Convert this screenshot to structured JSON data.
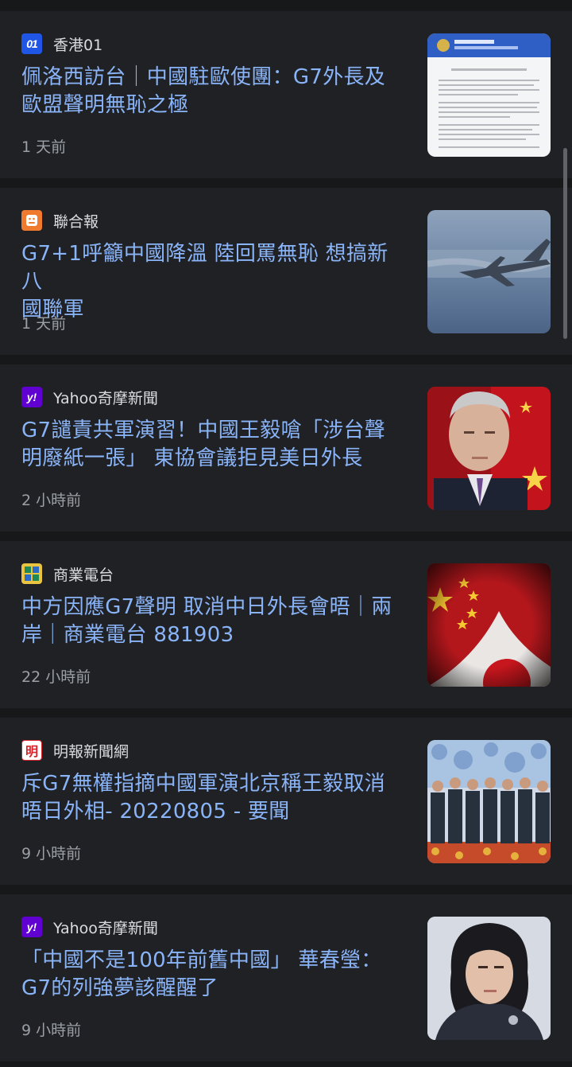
{
  "articles": [
    {
      "source": "香港01",
      "logo": "hk01-logo",
      "logo_color": "#1f56e6",
      "headline_lines": [
        "佩洛西訪台｜中國駐歐使團：G7外長及",
        "歐盟聲明無恥之極"
      ],
      "time": "1 天前",
      "thumbnail": "statement-document-image"
    },
    {
      "source": "聯合報",
      "logo": "udn-logo",
      "logo_color": "#f07a2e",
      "headline_lines": [
        "G7+1呼籲中國降溫 陸回罵無恥 想搞新八",
        "國聯軍"
      ],
      "time": "1 天前",
      "thumbnail": "military-aircraft-image"
    },
    {
      "source": "Yahoo奇摩新聞",
      "logo": "yahoo-logo",
      "logo_color": "#6001d2",
      "headline_lines": [
        "G7譴責共軍演習！中國王毅嗆「涉台聲",
        "明廢紙一張」 東協會議拒見美日外長"
      ],
      "time": "2 小時前",
      "thumbnail": "wang-yi-portrait-image"
    },
    {
      "source": "商業電台",
      "logo": "cr-logo",
      "logo_color": "#e8c441",
      "headline_lines": [
        "中方因應G7聲明 取消中日外長會晤｜兩",
        "岸｜商業電台 881903"
      ],
      "time": "22 小時前",
      "thumbnail": "china-japan-flags-image"
    },
    {
      "source": "明報新聞網",
      "logo": "mingpao-logo",
      "logo_color": "#d8232a",
      "headline_lines": [
        "斥G7無權指摘中國軍演北京稱王毅取消",
        "晤日外相- 20220805 - 要聞"
      ],
      "time": "9 小時前",
      "thumbnail": "asean-ministers-photo-image"
    },
    {
      "source": "Yahoo奇摩新聞",
      "logo": "yahoo-logo",
      "logo_color": "#6001d2",
      "headline_lines": [
        "「中國不是100年前舊中國」 華春瑩：",
        "G7的列強夢該醒醒了"
      ],
      "time": "9 小時前",
      "thumbnail": "hua-chunying-portrait-image"
    }
  ],
  "logo_text": {
    "hk01": "01",
    "yahoo": "y!",
    "mingpao": "明"
  }
}
